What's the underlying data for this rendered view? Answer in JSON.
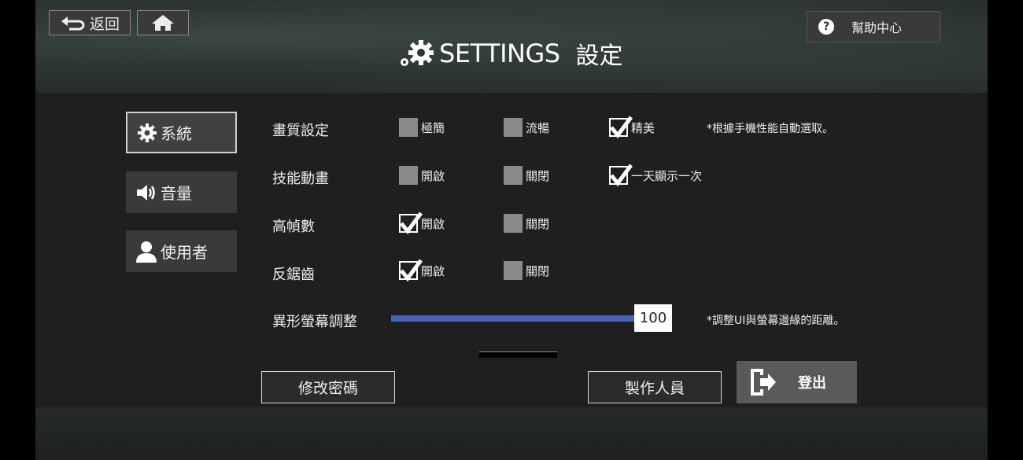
{
  "nav": {
    "back_label": "返回"
  },
  "help": {
    "label": "幫助中心"
  },
  "header": {
    "title_en": "SETTINGS",
    "title_zh": "設定"
  },
  "sidebar": {
    "items": [
      {
        "label": "系統",
        "active": true
      },
      {
        "label": "音量",
        "active": false
      },
      {
        "label": "使用者",
        "active": false
      }
    ]
  },
  "settings": {
    "quality": {
      "label": "畫質設定",
      "opt1": "極簡",
      "opt2": "流暢",
      "opt3": "精美",
      "selected": "精美",
      "note": "*根據手機性能自動選取。"
    },
    "skill_anim": {
      "label": "技能動畫",
      "opt1": "開啟",
      "opt2": "關閉",
      "opt3": "一天顯示一次",
      "selected": "一天顯示一次"
    },
    "high_fps": {
      "label": "高幀數",
      "opt1": "開啟",
      "opt2": "關閉",
      "selected": "開啟"
    },
    "antialias": {
      "label": "反鋸齒",
      "opt1": "開啟",
      "opt2": "關閉",
      "selected": "開啟"
    },
    "notch": {
      "label": "異形螢幕調整",
      "value": "100",
      "note": "*調整UI與螢幕邊緣的距離。"
    }
  },
  "actions": {
    "change_password": "修改密碼",
    "credits": "製作人員",
    "logout": "登出"
  },
  "colors": {
    "slider": "#4a63b5",
    "panel": "#1f1f1f"
  }
}
